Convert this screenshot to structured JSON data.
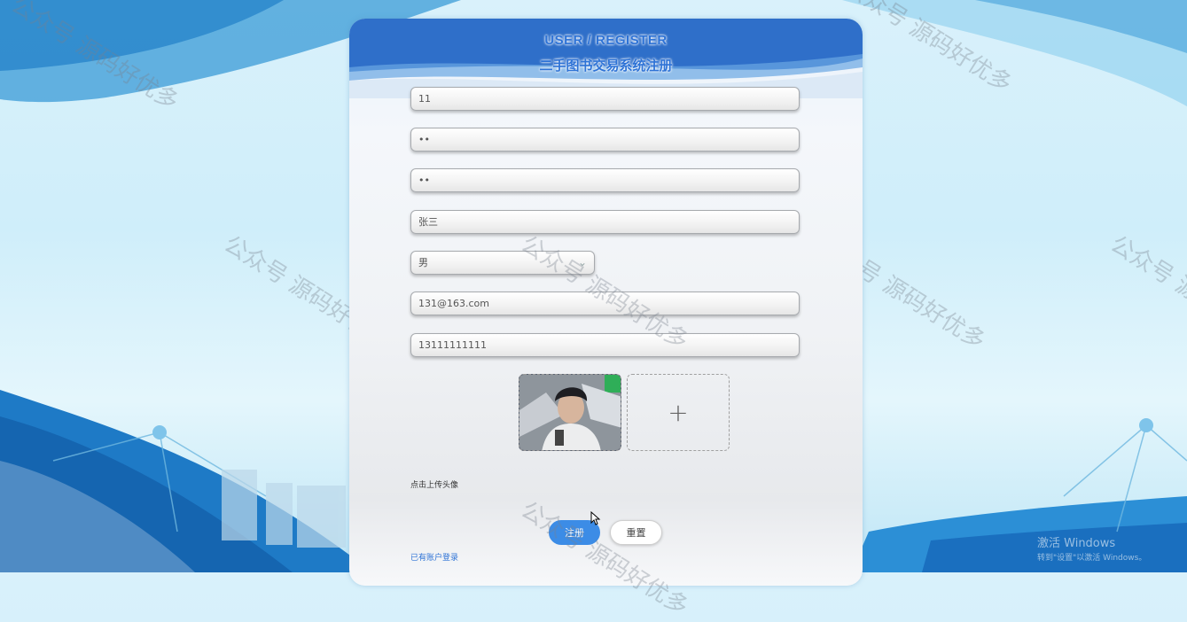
{
  "form": {
    "title_en": "USER / REGISTER",
    "title_cn": "二手图书交易系统注册",
    "username": "11",
    "password": "••",
    "confirm_password": "••",
    "name": "张三",
    "gender": "男",
    "email": "131@163.com",
    "phone": "13111111111",
    "upload_hint": "点击上传头像",
    "upload_add_symbol": "+",
    "register_label": "注册",
    "reset_label": "重置",
    "login_link": "已有账户登录"
  },
  "watermark": {
    "text": "公众号 源码好优多"
  },
  "os_overlay": {
    "line1": "激活 Windows",
    "line2": "转到\"设置\"以激活 Windows。"
  },
  "colors": {
    "accent": "#3c8ce6",
    "title": "#2e73d6"
  }
}
